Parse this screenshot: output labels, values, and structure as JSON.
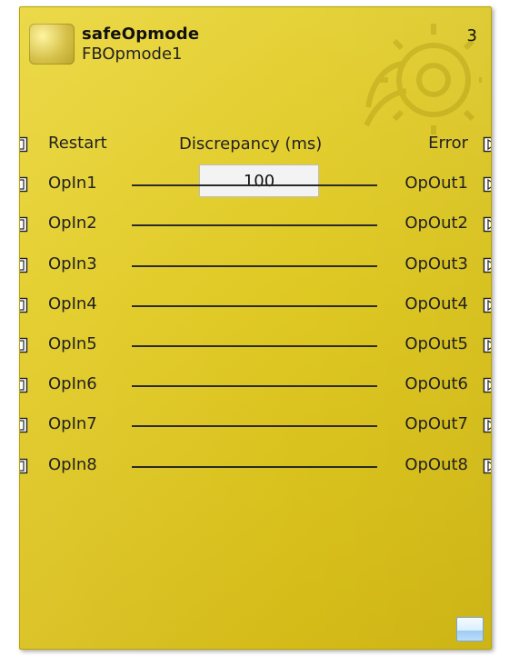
{
  "block": {
    "title": "safeOpmode",
    "instance_name": "FBOpmode1",
    "number": "3",
    "logo_icon": "safety-logo-icon",
    "watermark_icon": "gear-watermark-icon"
  },
  "parameters": {
    "discrepancy_label": "Discrepancy (ms)",
    "discrepancy_value": "100"
  },
  "ports": {
    "left": [
      {
        "label": "Restart"
      },
      {
        "label": "OpIn1"
      },
      {
        "label": "OpIn2"
      },
      {
        "label": "OpIn3"
      },
      {
        "label": "OpIn4"
      },
      {
        "label": "OpIn5"
      },
      {
        "label": "OpIn6"
      },
      {
        "label": "OpIn7"
      },
      {
        "label": "OpIn8"
      }
    ],
    "right": [
      {
        "label": "Error"
      },
      {
        "label": "OpOut1"
      },
      {
        "label": "OpOut2"
      },
      {
        "label": "OpOut3"
      },
      {
        "label": "OpOut4"
      },
      {
        "label": "OpOut5"
      },
      {
        "label": "OpOut6"
      },
      {
        "label": "OpOut7"
      },
      {
        "label": "OpOut8"
      }
    ]
  },
  "colors": {
    "block_yellow": "#e3cc23",
    "text_dark": "#222222",
    "input_bg": "#f3f3f3"
  }
}
